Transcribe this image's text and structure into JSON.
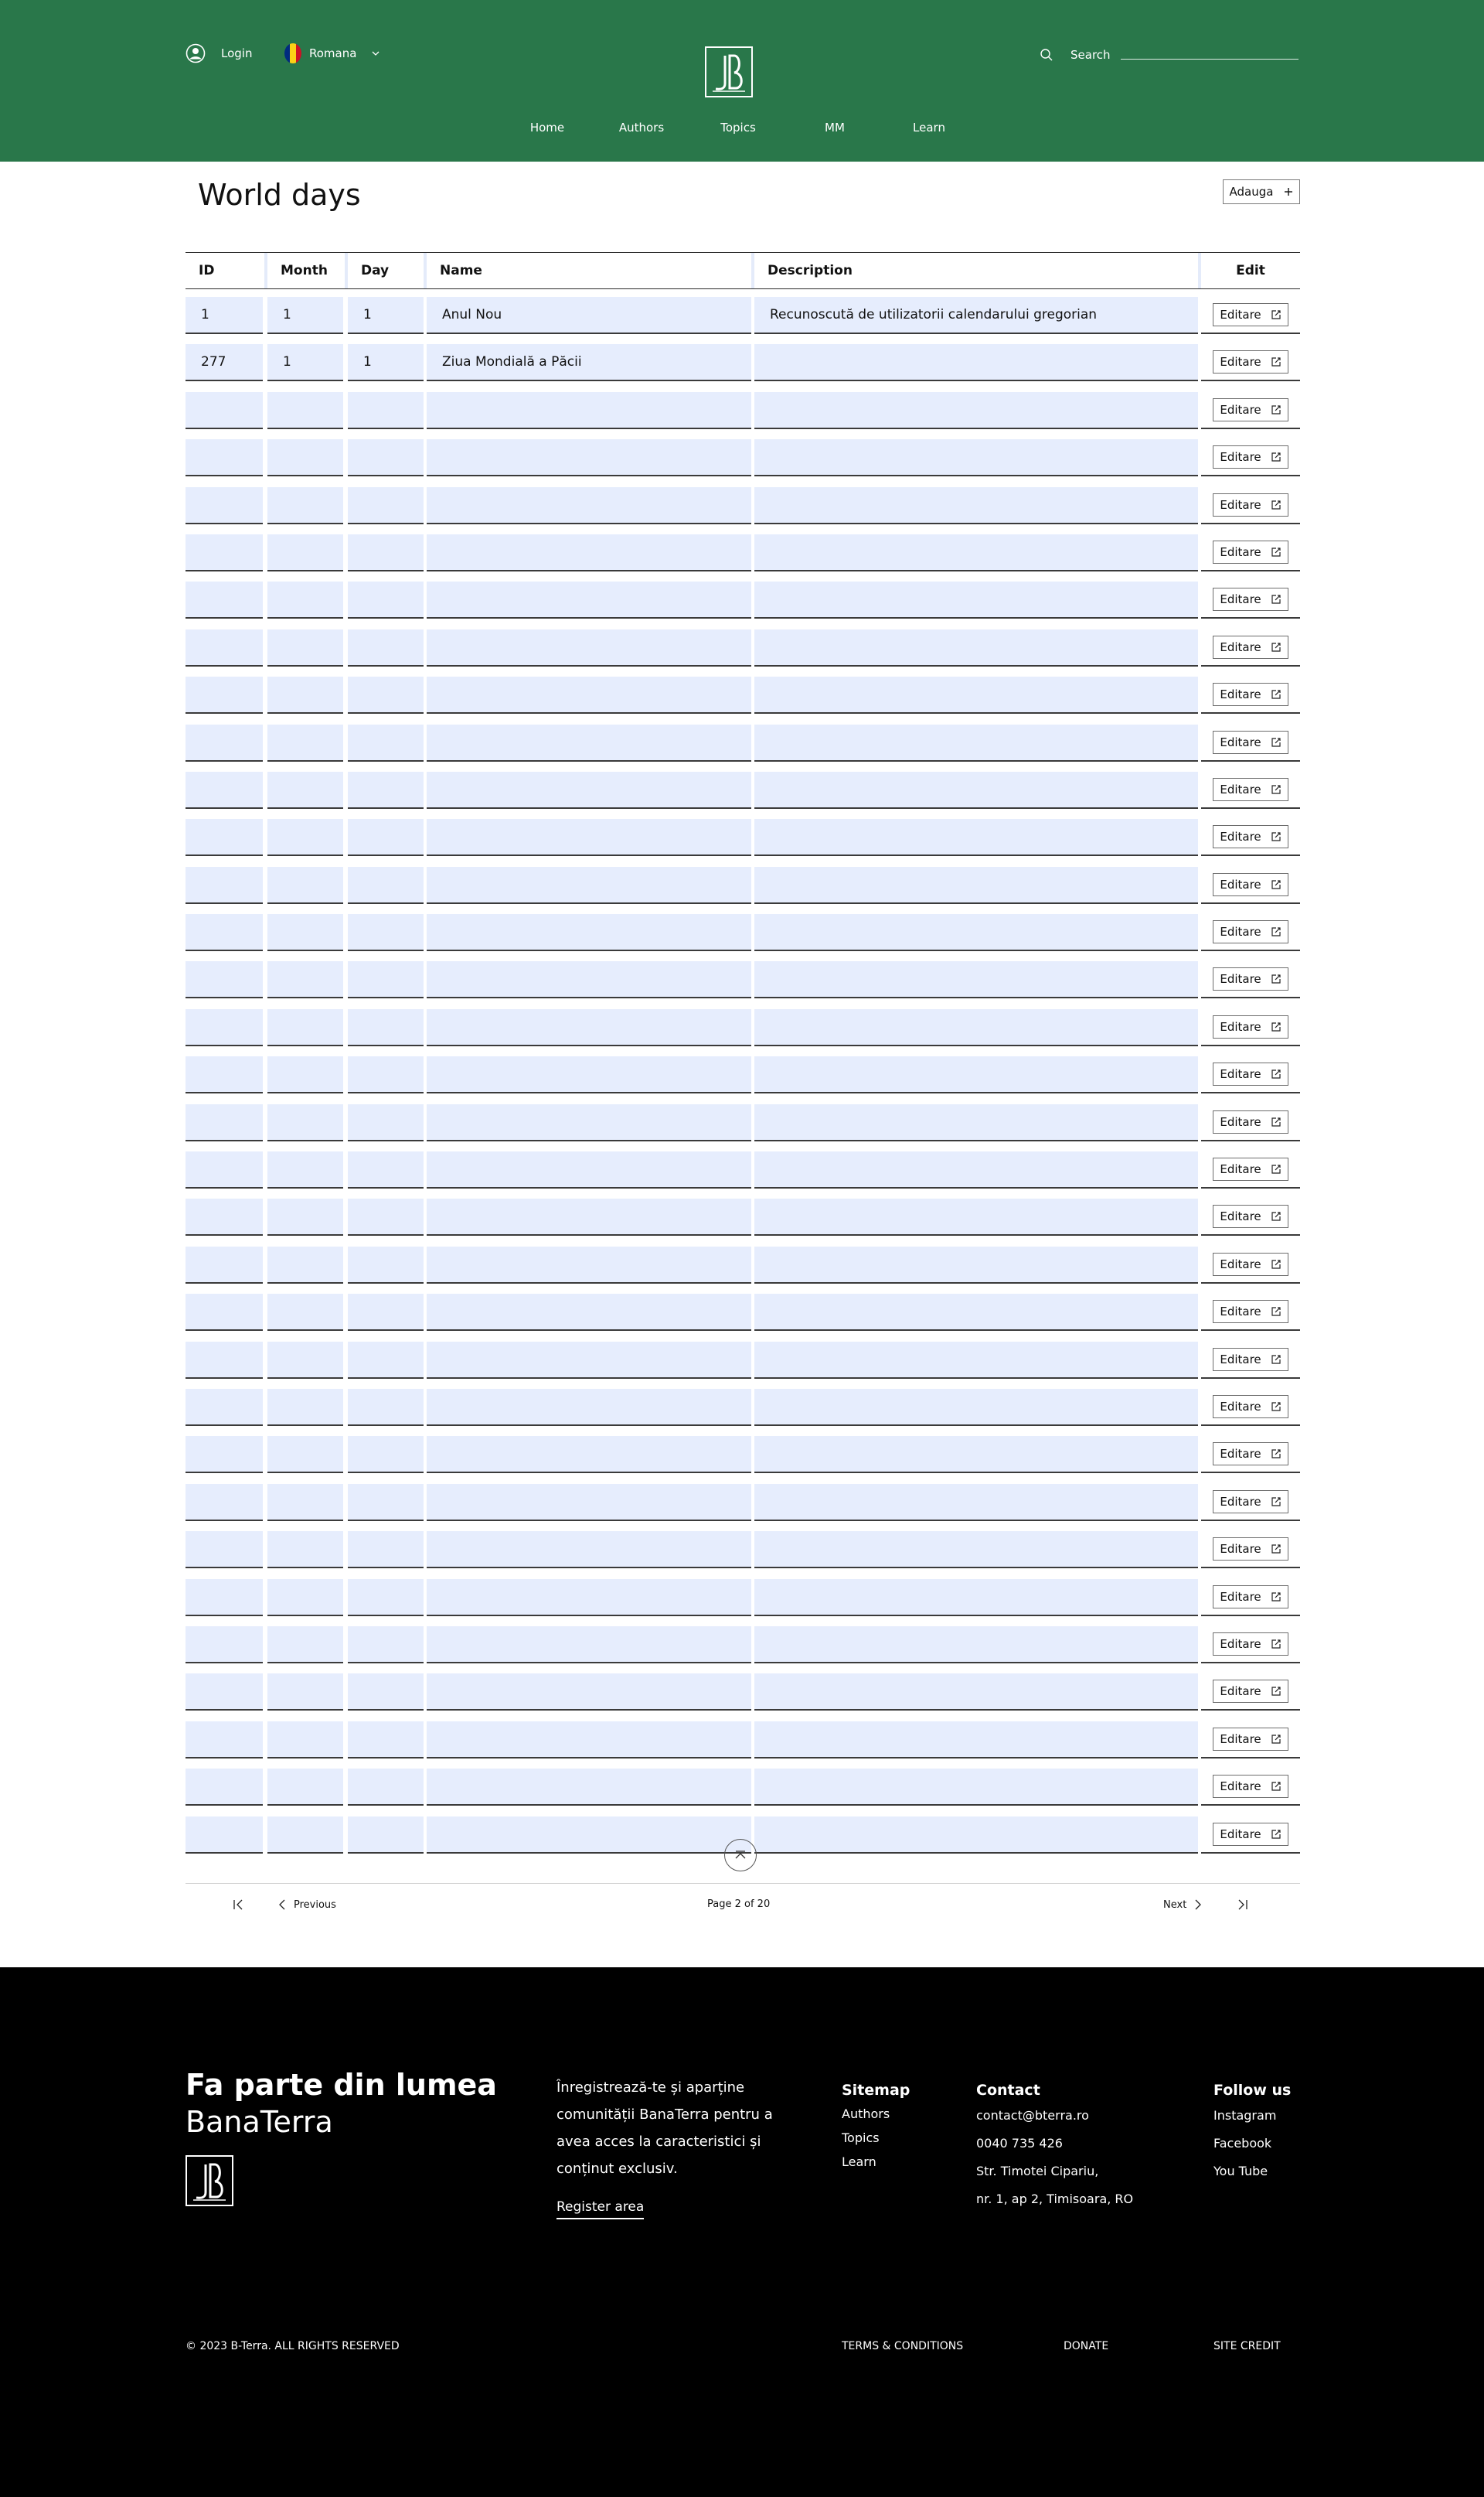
{
  "header": {
    "login_label": "Login",
    "language_label": "Romana",
    "search_label": "Search",
    "brand_color": "#29774a",
    "nav": [
      "Home",
      "Authors",
      "Topics",
      "MM",
      "Learn"
    ]
  },
  "main": {
    "title": "World days",
    "add_label": "Adauga",
    "table": {
      "headers": [
        "ID",
        "Month",
        "Day",
        "Name",
        "Description",
        "Edit"
      ],
      "rows": [
        {
          "id": "1",
          "month": "1",
          "day": "1",
          "name": "Anul Nou",
          "description": "Recunoscută de utilizatorii calendarului gregorian"
        },
        {
          "id": "277",
          "month": "1",
          "day": "1",
          "name": "Ziua Mondială a Păcii",
          "description": ""
        },
        {
          "id": "",
          "month": "",
          "day": "",
          "name": "",
          "description": ""
        },
        {
          "id": "",
          "month": "",
          "day": "",
          "name": "",
          "description": ""
        },
        {
          "id": "",
          "month": "",
          "day": "",
          "name": "",
          "description": ""
        },
        {
          "id": "",
          "month": "",
          "day": "",
          "name": "",
          "description": ""
        },
        {
          "id": "",
          "month": "",
          "day": "",
          "name": "",
          "description": ""
        },
        {
          "id": "",
          "month": "",
          "day": "",
          "name": "",
          "description": ""
        },
        {
          "id": "",
          "month": "",
          "day": "",
          "name": "",
          "description": ""
        },
        {
          "id": "",
          "month": "",
          "day": "",
          "name": "",
          "description": ""
        },
        {
          "id": "",
          "month": "",
          "day": "",
          "name": "",
          "description": ""
        },
        {
          "id": "",
          "month": "",
          "day": "",
          "name": "",
          "description": ""
        },
        {
          "id": "",
          "month": "",
          "day": "",
          "name": "",
          "description": ""
        },
        {
          "id": "",
          "month": "",
          "day": "",
          "name": "",
          "description": ""
        },
        {
          "id": "",
          "month": "",
          "day": "",
          "name": "",
          "description": ""
        },
        {
          "id": "",
          "month": "",
          "day": "",
          "name": "",
          "description": ""
        },
        {
          "id": "",
          "month": "",
          "day": "",
          "name": "",
          "description": ""
        },
        {
          "id": "",
          "month": "",
          "day": "",
          "name": "",
          "description": ""
        },
        {
          "id": "",
          "month": "",
          "day": "",
          "name": "",
          "description": ""
        },
        {
          "id": "",
          "month": "",
          "day": "",
          "name": "",
          "description": ""
        },
        {
          "id": "",
          "month": "",
          "day": "",
          "name": "",
          "description": ""
        },
        {
          "id": "",
          "month": "",
          "day": "",
          "name": "",
          "description": ""
        },
        {
          "id": "",
          "month": "",
          "day": "",
          "name": "",
          "description": ""
        },
        {
          "id": "",
          "month": "",
          "day": "",
          "name": "",
          "description": ""
        },
        {
          "id": "",
          "month": "",
          "day": "",
          "name": "",
          "description": ""
        },
        {
          "id": "",
          "month": "",
          "day": "",
          "name": "",
          "description": ""
        },
        {
          "id": "",
          "month": "",
          "day": "",
          "name": "",
          "description": ""
        },
        {
          "id": "",
          "month": "",
          "day": "",
          "name": "",
          "description": ""
        },
        {
          "id": "",
          "month": "",
          "day": "",
          "name": "",
          "description": ""
        },
        {
          "id": "",
          "month": "",
          "day": "",
          "name": "",
          "description": ""
        },
        {
          "id": "",
          "month": "",
          "day": "",
          "name": "",
          "description": ""
        },
        {
          "id": "",
          "month": "",
          "day": "",
          "name": "",
          "description": ""
        },
        {
          "id": "",
          "month": "",
          "day": "",
          "name": "",
          "description": ""
        }
      ],
      "edit_label": "Editare"
    },
    "pagination": {
      "previous_label": "Previous",
      "next_label": "Next",
      "page_info": "Page 2 of 20"
    }
  },
  "footer": {
    "title": "Fa parte din lumea",
    "subtitle": "BanaTerra",
    "blurb": "Înregistrează-te și aparține comunității BanaTerra pentru a avea acces la caracteristici și conținut exclusiv.",
    "register_label": "Register area",
    "sitemap": {
      "heading": "Sitemap",
      "links": [
        "Authors",
        "Topics",
        "Learn"
      ]
    },
    "contact": {
      "heading": "Contact",
      "lines": [
        "contact@bterra.ro",
        "0040 735 426",
        "Str. Timotei Cipariu,",
        "nr. 1, ap 2, Timisoara, RO"
      ]
    },
    "follow": {
      "heading": "Follow us",
      "links": [
        "Instagram",
        "Facebook",
        "You Tube"
      ]
    },
    "copyright": "© 2023 B-Terra. ALL RIGHTS RESERVED",
    "terms_label": "TERMS & CONDITIONS",
    "donate_label": "DONATE",
    "credit_label": "SITE CREDIT"
  }
}
